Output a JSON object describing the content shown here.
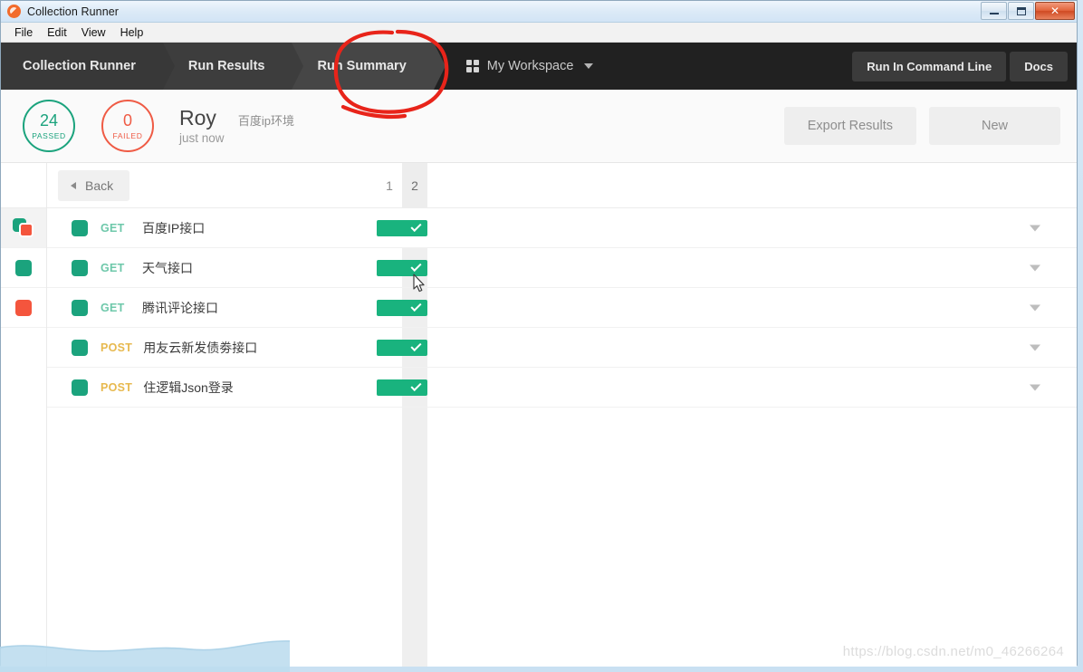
{
  "window": {
    "title": "Collection Runner",
    "logo_icon": "postman-logo-icon",
    "minimize_label": "Minimize",
    "maximize_label": "Maximize",
    "close_label": "✕"
  },
  "menubar": {
    "items": [
      {
        "label": "File"
      },
      {
        "label": "Edit"
      },
      {
        "label": "View"
      },
      {
        "label": "Help"
      }
    ]
  },
  "nav": {
    "crumbs": [
      {
        "label": "Collection Runner"
      },
      {
        "label": "Run Results"
      },
      {
        "label": "Run Summary"
      }
    ],
    "workspace": {
      "icon": "grid-icon",
      "label": "My Workspace",
      "caret_icon": "chevron-down-icon"
    },
    "buttons": [
      {
        "label": "Run In Command Line"
      },
      {
        "label": "Docs"
      }
    ]
  },
  "summary": {
    "passed": {
      "count": "24",
      "label": "PASSED",
      "color": "#1ba37d"
    },
    "failed": {
      "count": "0",
      "label": "FAILED",
      "color": "#ef5b45"
    },
    "run_name": "Roy",
    "environment": "百度ip环境",
    "timestamp": "just now",
    "export_label": "Export Results",
    "new_label": "New"
  },
  "results": {
    "back_label": "Back",
    "back_icon": "caret-left-icon",
    "filters": [
      {
        "name": "all-results-filter",
        "icon": "green-red-stack-icon",
        "active": true
      },
      {
        "name": "passed-filter",
        "icon": "green-square-icon",
        "active": false
      },
      {
        "name": "failed-filter",
        "icon": "red-square-icon",
        "active": false
      }
    ],
    "iterations": [
      {
        "label": "1",
        "highlighted": false
      },
      {
        "label": "2",
        "highlighted": true
      }
    ],
    "rows": [
      {
        "method": "GET",
        "name": "百度IP接口",
        "status": "passed",
        "status_icon": "check-icon"
      },
      {
        "method": "GET",
        "name": "天气接口",
        "status": "passed",
        "status_icon": "check-icon"
      },
      {
        "method": "GET",
        "name": "腾讯评论接口",
        "status": "passed",
        "status_icon": "check-icon"
      },
      {
        "method": "POST",
        "name": "用友云新发债劵接口",
        "status": "passed",
        "status_icon": "check-icon"
      },
      {
        "method": "POST",
        "name": "住逻辑Json登录",
        "status": "passed",
        "status_icon": "check-icon"
      }
    ]
  },
  "annotation": {
    "shape": "red-circle-annotation",
    "target": "Run Summary",
    "color": "#e8241a"
  },
  "watermark": {
    "text": "https://blog.csdn.net/m0_46266264"
  }
}
